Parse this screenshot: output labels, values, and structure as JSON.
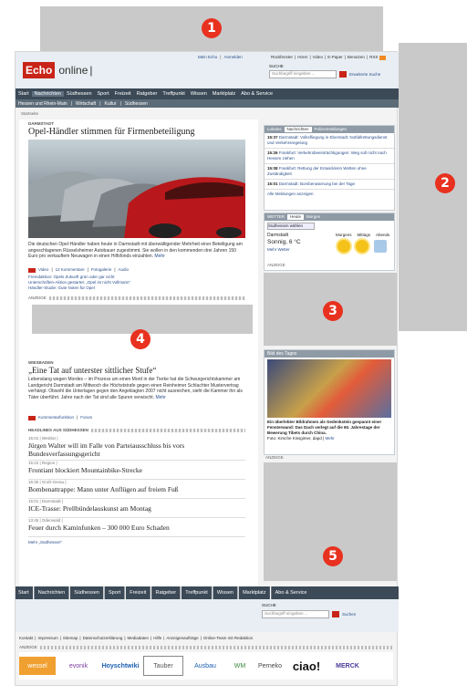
{
  "markers": [
    "1",
    "2",
    "3",
    "4",
    "5"
  ],
  "brand": {
    "echo": "Echo",
    "online": "online"
  },
  "header": {
    "top_links": [
      "Mein Echo",
      "Anmelden"
    ],
    "service_links": [
      "Rückfenster",
      "Hörer",
      "Video",
      "E-Paper",
      "Benutzen",
      "RSS"
    ],
    "search_label": "SUCHE",
    "search_placeholder": "Suchbegriff eingeben ...",
    "search_btn": "Erweiterte Suche",
    "search_go": "Suchen"
  },
  "nav": {
    "items": [
      "Start",
      "Nachrichten",
      "Südhessen",
      "Sport",
      "Freizeit",
      "Ratgeber",
      "Treffpunkt",
      "Wissen",
      "Marktplatz",
      "Abo & Service"
    ],
    "active": "Nachrichten",
    "sub": [
      "Hessen und Rhein-Main",
      "Wirtschaft",
      "Kultur",
      "Südhessen"
    ]
  },
  "breadcrumb": "Startseite",
  "lead": {
    "kicker": "DARMSTADT",
    "title": "Opel-Händler stimmen für Firmenbeteiligung",
    "text": "Die deutschen Opel-Händler haben heute in Darmstadt mit überwältigender Mehrheit einer Beteiligung am angeschlagenen Rüsselsheimer Autobauer zugestimmt. Sie wollen in den kommenden drei Jahren 150 Euro pro verkauftem Neuwagen in einen Hilfsfonds einzahlen.",
    "more": "Mehr",
    "meta": [
      "Video",
      "12 Kommentare",
      "Fotogalerie",
      "Audio"
    ],
    "related": [
      "Fremdaktion: Opels Zukunft grün oder gar nicht",
      "Unterschriften-Aktion gestartet: „Opel ist nicht Vollmann“",
      "Händler-Studie: Gute Noten für Opel"
    ]
  },
  "ad_label": "ANZEIGE",
  "story2": {
    "kicker": "WIESBADEN",
    "title": "„Eine Tat auf unterster sittlicher Stufe“",
    "text": "Lebenslang wegen Mordes – im Prozess um einen Mord in der Tierke hat die Schwurgerichtskammer am Landgericht Darmstadt am Mittwoch die Höchststrafe gegen einen Reinheimer Schlachter Mustervertrag verhängt. Obwohl die Unterlagen gegen den Angeklagten 2007 nicht ausreichen, sieht die Kammer ihn als Täter überführt. Jahre nach der Tat sind alle Spuren verwischt.",
    "more": "Mehr",
    "meta": [
      "Kommentarfunktion",
      "Forum"
    ]
  },
  "headlines_label": "HEADLINES AUS SÜDHESSEN",
  "headlines": [
    {
      "meta": "15:01 | Wetzlar |",
      "title": "Jürgen Walter will im Falle von Parteiausschluss bis vors Bundesverfassungsgericht"
    },
    {
      "meta": "15:22 | Region |",
      "title": "Frontiant blockiert Mountainbike-Strecke"
    },
    {
      "meta": "16:30 | Groß-Gerau |",
      "title": "Bombenattrappe: Mann unter Anflügen auf freiem Fuß"
    },
    {
      "meta": "15:01 | Darmstadt |",
      "title": "ICE-Trasse: Prellbündelauskunst am Montag"
    },
    {
      "meta": "13:45 | Odenwald |",
      "title": "Feuer durch Kaminfunken – 300 000 Euro Schaden"
    }
  ],
  "headlines_more": "Mehr „Südhessen“",
  "news_box": {
    "tabs": [
      "Lokales",
      "Nachrichten",
      "Polizeimeldungen"
    ],
    "items": [
      {
        "time": "15:37",
        "text": "Darmstadt: Volksfliegung in Eberstadt: Notfallrettungsdienst und Verkehrsregelung"
      },
      {
        "time": "15:26",
        "text": "Frankfurt: Verkehrsbeeinträchtigungen: Weg soll nicht nach Hessen ziehen"
      },
      {
        "time": "15:08",
        "text": "Frankfurt: Rettung der Entwicklerin Wetten ohne Zuständigkeit"
      },
      {
        "time": "15:01",
        "text": "Darmstadt: Bombenwarnung bei der Tage"
      }
    ],
    "more": "Alle Meldungen anzeigen"
  },
  "weather": {
    "tabs": [
      "WETTER",
      "Heute",
      "Morgen"
    ],
    "select": "Südhessen wählen",
    "city": "Darmstadt",
    "condition": "Sonnig, 6 °C",
    "more": "Mehr Wetter",
    "labels": [
      "Morgens",
      "Mittags",
      "Abends"
    ],
    "ad": "ANZEIGE"
  },
  "photo": {
    "label": "Bild des Tages",
    "caption": "Ein überlebter Bildrahmen als Gedenkstein gespannt einer Fensterwand: Das Dach verlegt auf die 60. Jahrestage der Bewerung Tibets durch China.",
    "credit": "Foto: Kirsche Kissgimer, dapd",
    "more": "Mehr",
    "ad": "ANZEIGE"
  },
  "footer": {
    "nav": [
      "Start",
      "Nachrichten",
      "Südhessen",
      "Sport",
      "Freizeit",
      "Ratgeber",
      "Treffpunkt",
      "Wissen",
      "Marktplatz",
      "Abo & Service"
    ],
    "links": [
      "Kontakt",
      "Impressum",
      "Sitemap",
      "Datenschutzerklärung",
      "Mediadaten",
      "Hilfe",
      "Anzeigenaufträge",
      "Online-Team mit Redaktion"
    ],
    "ad": "ANZEIGE",
    "sponsors": [
      "wessel",
      "evonik",
      "Hoyschtwiki",
      "Tauber",
      "Ausbau",
      "WM",
      "Perneko",
      "ciao!",
      "MERCK"
    ]
  }
}
